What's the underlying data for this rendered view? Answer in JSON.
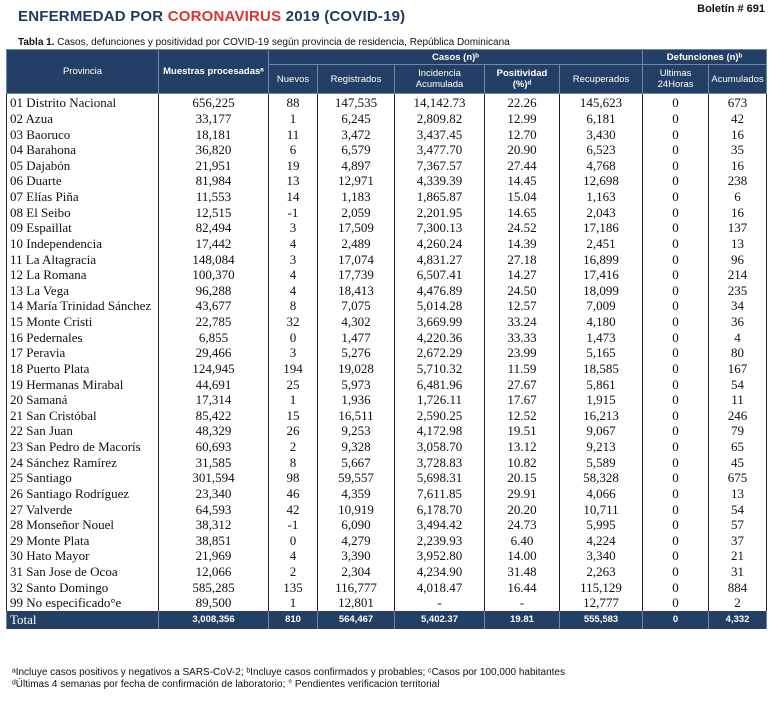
{
  "header": {
    "title_prefix": "ENFERMEDAD POR ",
    "title_highlight": "CORONAVIRUS",
    "title_suffix": " 2019 (COVID-19)",
    "bulletin": "Boletín # 691"
  },
  "caption": {
    "label": "Tabla 1.",
    "text": " Casos, defunciones y positividad por COVID-19 según provincia de residencia, República Dominicana"
  },
  "columns": {
    "provincia": "Provincia",
    "muestras": "Muestras procesadasᵃ",
    "casos_group": "Casos (n)ᵇ",
    "defunciones_group": "Defunciones (n)ᵇ",
    "nuevos": "Nuevos",
    "registrados": "Registrados",
    "incidencia": "Incidencia Acumulada",
    "positividad": "Positividad (%)ᵈ",
    "recuperados": "Recuperados",
    "ultimas": "Ultimas 24Horas",
    "acumulados": "Acumulados"
  },
  "rows": [
    [
      "01 Distrito Nacional",
      "656,225",
      "88",
      "147,535",
      "14,142.73",
      "22.26",
      "145,623",
      "0",
      "673"
    ],
    [
      "02 Azua",
      "33,177",
      "1",
      "6,245",
      "2,809.82",
      "12.99",
      "6,181",
      "0",
      "42"
    ],
    [
      "03 Baoruco",
      "18,181",
      "11",
      "3,472",
      "3,437.45",
      "12.70",
      "3,430",
      "0",
      "16"
    ],
    [
      "04 Barahona",
      "36,820",
      "6",
      "6,579",
      "3,477.70",
      "20.90",
      "6,523",
      "0",
      "35"
    ],
    [
      "05 Dajabón",
      "21,951",
      "19",
      "4,897",
      "7,367.57",
      "27.44",
      "4,768",
      "0",
      "16"
    ],
    [
      "06 Duarte",
      "81,984",
      "13",
      "12,971",
      "4,339.39",
      "14.45",
      "12,698",
      "0",
      "238"
    ],
    [
      "07 Elías Piña",
      "11,553",
      "14",
      "1,183",
      "1,865.87",
      "15.04",
      "1,163",
      "0",
      "6"
    ],
    [
      "08 El Seibo",
      "12,515",
      "-1",
      "2,059",
      "2,201.95",
      "14.65",
      "2,043",
      "0",
      "16"
    ],
    [
      "09 Espaillat",
      "82,494",
      "3",
      "17,509",
      "7,300.13",
      "24.52",
      "17,186",
      "0",
      "137"
    ],
    [
      "10 Independencia",
      "17,442",
      "4",
      "2,489",
      "4,260.24",
      "14.39",
      "2,451",
      "0",
      "13"
    ],
    [
      "11 La Altagracia",
      "148,084",
      "3",
      "17,074",
      "4,831.27",
      "27.18",
      "16,899",
      "0",
      "96"
    ],
    [
      "12 La Romana",
      "100,370",
      "4",
      "17,739",
      "6,507.41",
      "14.27",
      "17,416",
      "0",
      "214"
    ],
    [
      "13 La Vega",
      "96,288",
      "4",
      "18,413",
      "4,476.89",
      "24.50",
      "18,099",
      "0",
      "235"
    ],
    [
      "14 María Trinidad Sánchez",
      "43,677",
      "8",
      "7,075",
      "5,014.28",
      "12.57",
      "7,009",
      "0",
      "34"
    ],
    [
      "15 Monte Cristi",
      "22,785",
      "32",
      "4,302",
      "3,669.99",
      "33.24",
      "4,180",
      "0",
      "36"
    ],
    [
      "16 Pedernales",
      "6,855",
      "0",
      "1,477",
      "4,220.36",
      "33.33",
      "1,473",
      "0",
      "4"
    ],
    [
      "17 Peravia",
      "29,466",
      "3",
      "5,276",
      "2,672.29",
      "23.99",
      "5,165",
      "0",
      "80"
    ],
    [
      "18 Puerto Plata",
      "124,945",
      "194",
      "19,028",
      "5,710.32",
      "11.59",
      "18,585",
      "0",
      "167"
    ],
    [
      "19 Hermanas Mirabal",
      "44,691",
      "25",
      "5,973",
      "6,481.96",
      "27.67",
      "5,861",
      "0",
      "54"
    ],
    [
      "20 Samaná",
      "17,314",
      "1",
      "1,936",
      "1,726.11",
      "17.67",
      "1,915",
      "0",
      "11"
    ],
    [
      "21 San Cristóbal",
      "85,422",
      "15",
      "16,511",
      "2,590.25",
      "12.52",
      "16,213",
      "0",
      "246"
    ],
    [
      "22 San Juan",
      "48,329",
      "26",
      "9,253",
      "4,172.98",
      "19.51",
      "9,067",
      "0",
      "79"
    ],
    [
      "23 San Pedro de Macorís",
      "60,693",
      "2",
      "9,328",
      "3,058.70",
      "13.12",
      "9,213",
      "0",
      "65"
    ],
    [
      "24 Sánchez Ramírez",
      "31,585",
      "8",
      "5,667",
      "3,728.83",
      "10.82",
      "5,589",
      "0",
      "45"
    ],
    [
      "25 Santiago",
      "301,594",
      "98",
      "59,557",
      "5,698.31",
      "20.15",
      "58,328",
      "0",
      "675"
    ],
    [
      "26 Santiago Rodríguez",
      "23,340",
      "46",
      "4,359",
      "7,611.85",
      "29.91",
      "4,066",
      "0",
      "13"
    ],
    [
      "27 Valverde",
      "64,593",
      "42",
      "10,919",
      "6,178.70",
      "20.20",
      "10,711",
      "0",
      "54"
    ],
    [
      "28 Monseñor Nouel",
      "38,312",
      "-1",
      "6,090",
      "3,494.42",
      "24.73",
      "5,995",
      "0",
      "57"
    ],
    [
      "29 Monte Plata",
      "38,851",
      "0",
      "4,279",
      "2,239.93",
      "6.40",
      "4,224",
      "0",
      "37"
    ],
    [
      "30 Hato Mayor",
      "21,969",
      "4",
      "3,390",
      "3,952.80",
      "14.00",
      "3,340",
      "0",
      "21"
    ],
    [
      "31 San Jose de Ocoa",
      "12,066",
      "2",
      "2,304",
      "4,234.90",
      "31.48",
      "2,263",
      "0",
      "31"
    ],
    [
      "32 Santo Domingo",
      "585,285",
      "135",
      "116,777",
      "4,018.47",
      "16.44",
      "115,129",
      "0",
      "884"
    ],
    [
      "99 No especificado°e",
      "89,500",
      "1",
      "12,801",
      "-",
      "-",
      "12,777",
      "0",
      "2"
    ]
  ],
  "total": [
    "Total",
    "3,008,356",
    "810",
    "564,467",
    "5,402.37",
    "19.81",
    "555,583",
    "0",
    "4,332"
  ],
  "notes": [
    "ᵃIncluye casos positivos y negativos a SARS-CoV-2; ᵇIncluye casos confirmados y probables; ᶜCasos por 100,000 habitantes",
    "ᵈÚltimas 4 semanas por fecha de confirmación de laboratorio; ° Pendientes verificacion territorial"
  ]
}
